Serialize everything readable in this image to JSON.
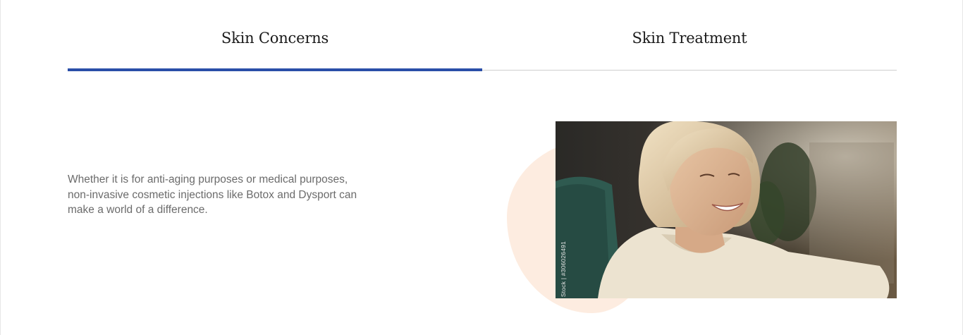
{
  "tabs": [
    {
      "label": "Skin Concerns",
      "active": true
    },
    {
      "label": "Skin Treatment",
      "active": false
    }
  ],
  "content": {
    "description": "Whether it is for anti-aging purposes or medical purposes, non-invasive cosmetic injections like Botox and Dysport can make a world of a difference.",
    "image_watermark": "Stock | #306026491"
  },
  "colors": {
    "accent": "#2a4fa8",
    "blob": "#fdece0",
    "text": "#6b6b6b",
    "tab_text": "#1a1a1a"
  }
}
